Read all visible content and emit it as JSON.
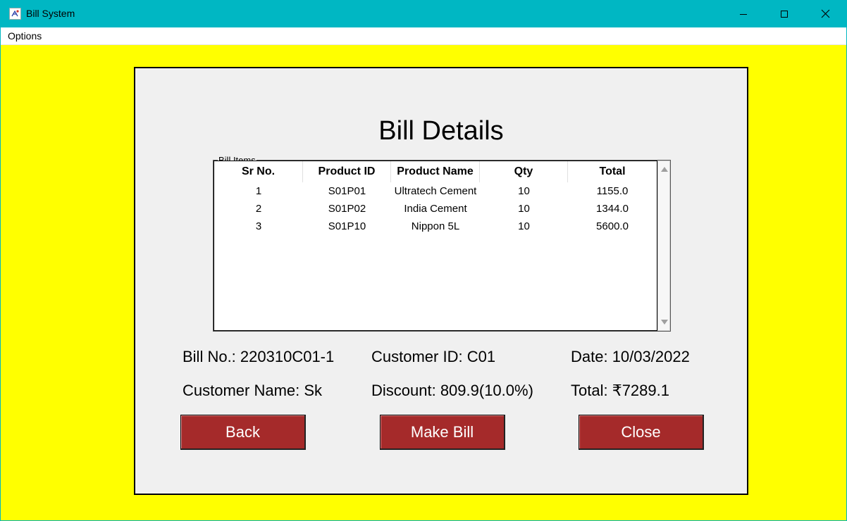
{
  "window": {
    "title": "Bill System",
    "icon": "app-icon",
    "controls": [
      "minimize-icon",
      "maximize-icon",
      "close-icon"
    ]
  },
  "menu": {
    "options_label": "Options"
  },
  "colors": {
    "titlebar": "#00b7c3",
    "background": "#ffff00",
    "panel": "#f0f0f0",
    "button": "#a52a2a"
  },
  "heading": "Bill Details",
  "bill_items": {
    "group_label": "Bill Items",
    "columns": [
      "Sr No.",
      "Product ID",
      "Product Name",
      "Qty",
      "Total"
    ],
    "rows": [
      [
        "1",
        "S01P01",
        "Ultratech Cement",
        "10",
        "1155.0"
      ],
      [
        "2",
        "S01P02",
        "India Cement",
        "10",
        "1344.0"
      ],
      [
        "3",
        "S01P10",
        "Nippon 5L",
        "10",
        "5600.0"
      ]
    ]
  },
  "summary": {
    "bill_no": "Bill No.: 220310C01-1",
    "customer_id": "Customer ID: C01",
    "date": "Date: 10/03/2022",
    "customer_name": "Customer Name: Sk",
    "discount": "Discount: 809.9(10.0%)",
    "total": "Total: ₹7289.1"
  },
  "buttons": {
    "back": "Back",
    "make_bill": "Make Bill",
    "close": "Close"
  }
}
